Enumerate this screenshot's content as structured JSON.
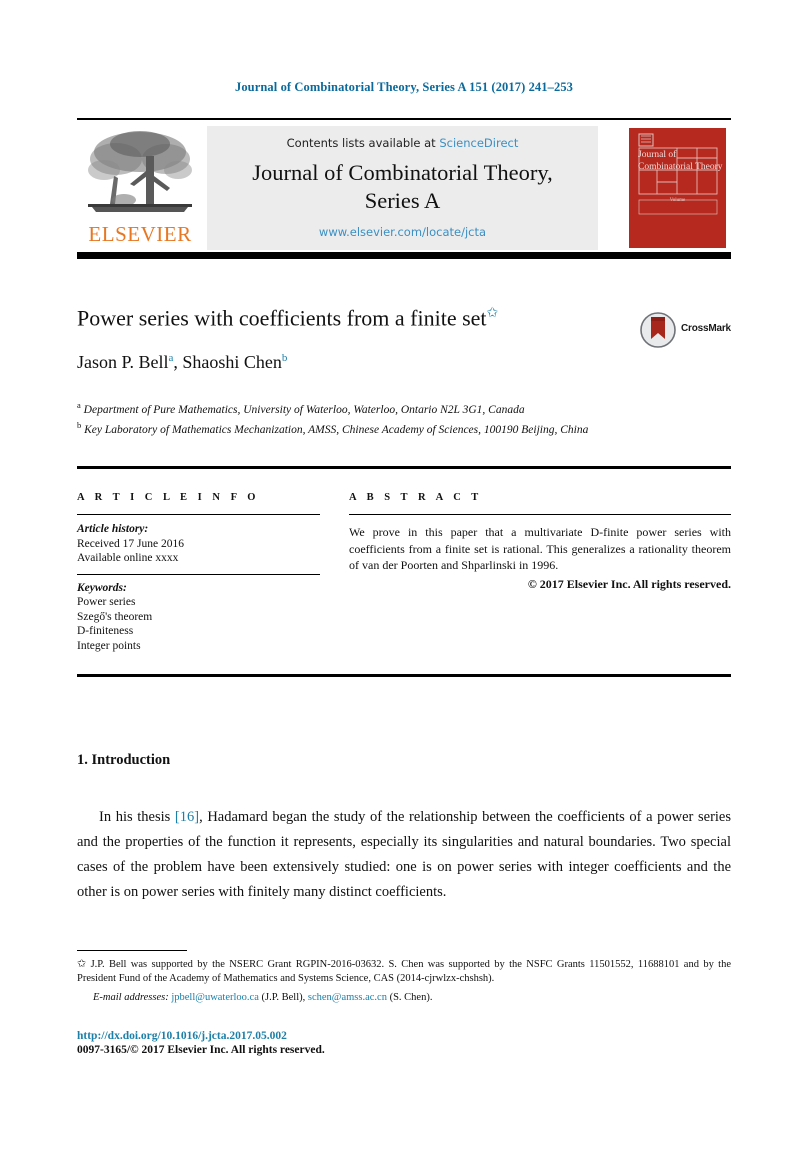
{
  "running_head": "Journal of Combinatorial Theory, Series A 151 (2017) 241–253",
  "masthead": {
    "contents_prefix": "Contents lists available at ",
    "sciencedirect": "ScienceDirect",
    "journal_name_line1": "Journal of Combinatorial Theory,",
    "journal_name_line2": "Series A",
    "journal_url": "www.elsevier.com/locate/jcta",
    "publisher_logo_text": "ELSEVIER",
    "cover_title": "Journal of Combinatorial Theory",
    "cover_volume": "Volume",
    "accent_link_color": "#3a8fc4",
    "elsevier_orange": "#E87722",
    "cover_red": "#b5291f"
  },
  "article": {
    "title": "Power series with coefficients from a finite set",
    "title_footnote_mark": "✩",
    "authors": "Jason P. Bell",
    "author_a_mark": "a",
    "author_two": ", Shaoshi Chen",
    "author_b_mark": "b",
    "affiliation_a_mark": "a",
    "affiliation_a": " Department of Pure Mathematics, University of Waterloo, Waterloo, Ontario N2L 3G1, Canada",
    "affiliation_b_mark": "b",
    "affiliation_b": " Key Laboratory of Mathematics Mechanization, AMSS, Chinese Academy of Sciences, 100190 Beijing, China",
    "crossmark_label": "CrossMark"
  },
  "article_info": {
    "heading": "A R T I C L E   I N F O",
    "history_label": "Article history:",
    "received": "Received 17 June 2016",
    "available_online": "Available online xxxx",
    "keywords_label": "Keywords:",
    "keywords": [
      "Power series",
      "Szegő's theorem",
      "D-finiteness",
      "Integer points"
    ]
  },
  "abstract": {
    "heading": "A B S T R A C T",
    "text": "We prove in this paper that a multivariate D-finite power series with coefficients from a finite set is rational. This generalizes a rationality theorem of van der Poorten and Shparlinski in 1996.",
    "copyright": "© 2017 Elsevier Inc. All rights reserved."
  },
  "body": {
    "section_number_title": "1. Introduction",
    "paragraph_part1": "In his thesis ",
    "citation": "[16]",
    "paragraph_part2": ", Hadamard began the study of the relationship between the coefficients of a power series and the properties of the function it represents, especially its singularities and natural boundaries. Two special cases of the problem have been extensively studied: one is on power series with integer coefficients and the other is on power series with finitely many distinct coefficients."
  },
  "footnotes": {
    "star_mark": "✩",
    "funding": "J.P. Bell was supported by the NSERC Grant RGPIN-2016-03632. S. Chen was supported by the NSFC Grants 11501552, 11688101 and by the President Fund of the Academy of Mathematics and Systems Science, CAS (2014-cjrwlzx-chshsh).",
    "email_label": "E-mail addresses:",
    "email_1": "jpbell@uwaterloo.ca",
    "email_1_owner": " (J.P. Bell), ",
    "email_2": "schen@amss.ac.cn",
    "email_2_owner": " (S. Chen).",
    "doi": "http://dx.doi.org/10.1016/j.jcta.2017.05.002",
    "issn_line": "0097-3165/© 2017 Elsevier Inc. All rights reserved."
  }
}
